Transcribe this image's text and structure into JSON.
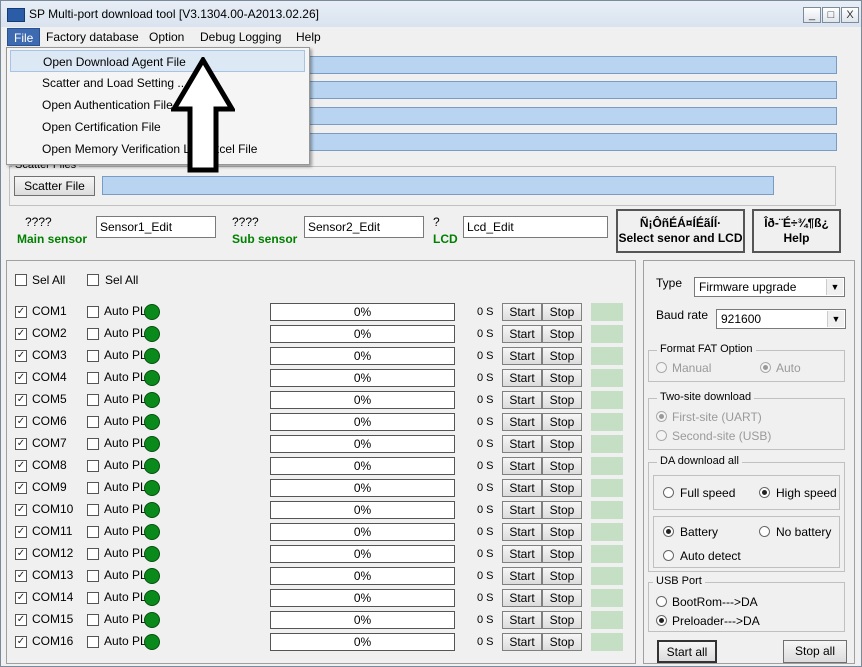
{
  "window": {
    "title": "SP Multi-port download tool [V3.1304.00-A2013.02.26]",
    "controls": [
      "_",
      "□",
      "X"
    ]
  },
  "menu": [
    "File",
    "Factory database",
    "Option",
    "Debug Logging",
    "Help"
  ],
  "file_menu": [
    "Open Download Agent File",
    "Scatter and Load Setting ...",
    "Open Authentication File",
    "Open Certification File",
    "Open Memory Verification List Excel File"
  ],
  "scatter": {
    "group_label": "Scatter Files",
    "button": "Scatter File"
  },
  "sensors": {
    "main_q": "????",
    "main_label": "Main sensor",
    "main_value": "Sensor1_Edit",
    "sub_q": "????",
    "sub_label": "Sub sensor",
    "sub_value": "Sensor2_Edit",
    "lcd_q": "?",
    "lcd_label": "LCD",
    "lcd_value": "Lcd_Edit",
    "select_btn_line1": "Ñ¡ÔñÉÁ¤ÍÉãÍÍ·",
    "select_btn_line2": "Select senor and LCD",
    "help_btn_line1": "Îð-¨É÷¾¶ß¿",
    "help_btn_line2": "Help"
  },
  "select_all": [
    "Sel All",
    "Sel All"
  ],
  "ports": [
    {
      "com": "COM1",
      "auto": "Auto PL",
      "progress": "0%",
      "time": "0 S",
      "start": "Start",
      "stop": "Stop"
    },
    {
      "com": "COM2",
      "auto": "Auto PL",
      "progress": "0%",
      "time": "0 S",
      "start": "Start",
      "stop": "Stop"
    },
    {
      "com": "COM3",
      "auto": "Auto PL",
      "progress": "0%",
      "time": "0 S",
      "start": "Start",
      "stop": "Stop"
    },
    {
      "com": "COM4",
      "auto": "Auto PL",
      "progress": "0%",
      "time": "0 S",
      "start": "Start",
      "stop": "Stop"
    },
    {
      "com": "COM5",
      "auto": "Auto PL",
      "progress": "0%",
      "time": "0 S",
      "start": "Start",
      "stop": "Stop"
    },
    {
      "com": "COM6",
      "auto": "Auto PL",
      "progress": "0%",
      "time": "0 S",
      "start": "Start",
      "stop": "Stop"
    },
    {
      "com": "COM7",
      "auto": "Auto PL",
      "progress": "0%",
      "time": "0 S",
      "start": "Start",
      "stop": "Stop"
    },
    {
      "com": "COM8",
      "auto": "Auto PL",
      "progress": "0%",
      "time": "0 S",
      "start": "Start",
      "stop": "Stop"
    },
    {
      "com": "COM9",
      "auto": "Auto PL",
      "progress": "0%",
      "time": "0 S",
      "start": "Start",
      "stop": "Stop"
    },
    {
      "com": "COM10",
      "auto": "Auto PL",
      "progress": "0%",
      "time": "0 S",
      "start": "Start",
      "stop": "Stop"
    },
    {
      "com": "COM11",
      "auto": "Auto PL",
      "progress": "0%",
      "time": "0 S",
      "start": "Start",
      "stop": "Stop"
    },
    {
      "com": "COM12",
      "auto": "Auto PL",
      "progress": "0%",
      "time": "0 S",
      "start": "Start",
      "stop": "Stop"
    },
    {
      "com": "COM13",
      "auto": "Auto PL",
      "progress": "0%",
      "time": "0 S",
      "start": "Start",
      "stop": "Stop"
    },
    {
      "com": "COM14",
      "auto": "Auto PL",
      "progress": "0%",
      "time": "0 S",
      "start": "Start",
      "stop": "Stop"
    },
    {
      "com": "COM15",
      "auto": "Auto PL",
      "progress": "0%",
      "time": "0 S",
      "start": "Start",
      "stop": "Stop"
    },
    {
      "com": "COM16",
      "auto": "Auto PL",
      "progress": "0%",
      "time": "0 S",
      "start": "Start",
      "stop": "Stop"
    }
  ],
  "settings": {
    "type_label": "Type",
    "type_value": "Firmware upgrade",
    "baud_label": "Baud rate",
    "baud_value": "921600",
    "fat_title": "Format FAT Option",
    "fat_manual": "Manual",
    "fat_auto": "Auto",
    "twosite_title": "Two-site download",
    "twosite_first": "First-site (UART)",
    "twosite_second": "Second-site (USB)",
    "da_title": "DA download all",
    "da_full": "Full speed",
    "da_high": "High speed",
    "battery": "Battery",
    "no_battery": "No battery",
    "auto_detect": "Auto detect",
    "usb_title": "USB Port",
    "usb_bootrom": "BootRom--->DA",
    "usb_preloader": "Preloader--->DA"
  },
  "footer": {
    "start_all": "Start all",
    "stop_all": "Stop all"
  },
  "colors": {
    "field_blue": "#b8d4f0",
    "led_green": "#0a8a1a",
    "status_green": "#c5dfc5",
    "menu_active": "#3d6ab0"
  }
}
